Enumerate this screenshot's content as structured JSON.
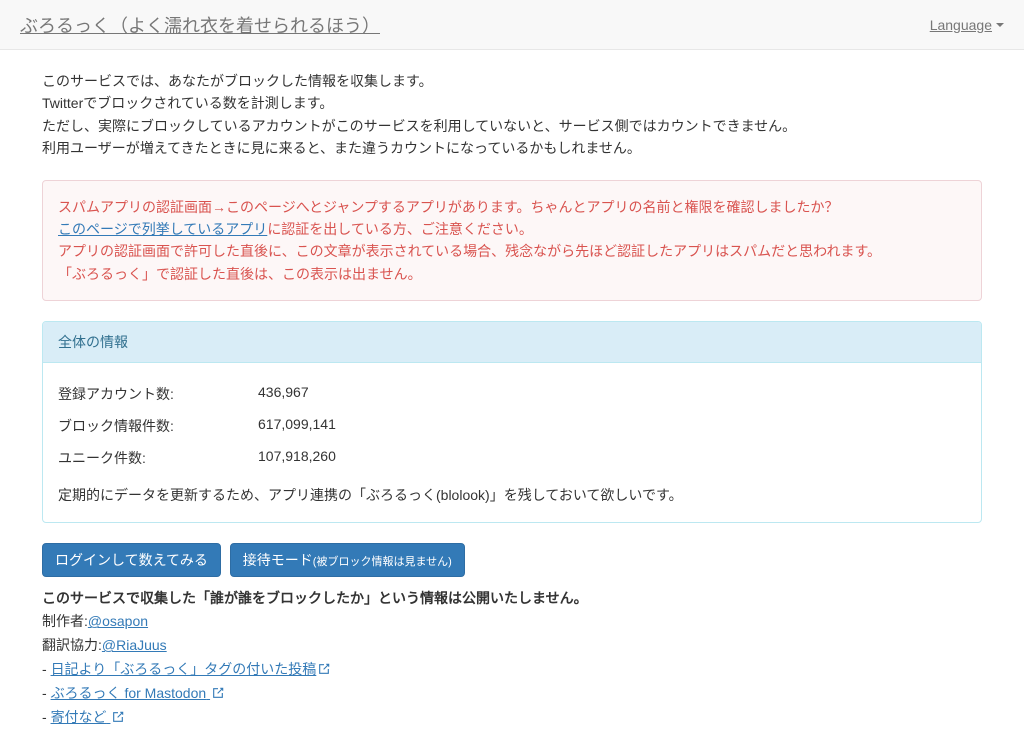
{
  "navbar": {
    "brand": "ぶろるっく（よく濡れ衣を着せられるほう）",
    "language_label": "Language"
  },
  "intro": {
    "line1": "このサービスでは、あなたがブロックした情報を収集します。",
    "line2": "Twitterでブロックされている数を計測します。",
    "line3": "ただし、実際にブロックしているアカウントがこのサービスを利用していないと、サービス側ではカウントできません。",
    "line4": "利用ユーザーが増えてきたときに見に来ると、また違うカウントになっているかもしれません。"
  },
  "alert": {
    "part1": "スパムアプリの認証画面→このページへとジャンプするアプリがあります。ちゃんとアプリの名前と権限を確認しましたか？",
    "link": "このページで列挙しているアプリ",
    "part2": "に認証を出している方、ご注意ください。",
    "part3": "アプリの認証画面で許可した直後に、この文章が表示されている場合、残念ながら先ほど認証したアプリはスパムだと思われます。",
    "part4": "「ぶろるっく」で認証した直後は、この表示は出ません。"
  },
  "panel": {
    "heading": "全体の情報",
    "stats": [
      {
        "label": "登録アカウント数:",
        "value": "436,967"
      },
      {
        "label": "ブロック情報件数:",
        "value": "617,099,141"
      },
      {
        "label": "ユニーク件数:",
        "value": "107,918,260"
      }
    ],
    "note": "定期的にデータを更新するため、アプリ連携の「ぶろるっく(blolook)」を残しておいて欲しいです。"
  },
  "buttons": {
    "login": "ログインして数えてみる",
    "mode_prefix": "接待モード",
    "mode_suffix": "(被ブロック情報は見ません)"
  },
  "footer": {
    "disclaimer": "このサービスで収集した「誰が誰をブロックしたか」という情報は公開いたしません。",
    "author_label": "制作者:",
    "author_handle": "@osapon",
    "translator_label": "翻訳協力:",
    "translator_handle": "@RiaJuus",
    "link1": "日記より「ぶろるっく」タグの付いた投稿",
    "link2": "ぶろるっく for Mastodon",
    "link3": "寄付など",
    "dash": "-"
  }
}
